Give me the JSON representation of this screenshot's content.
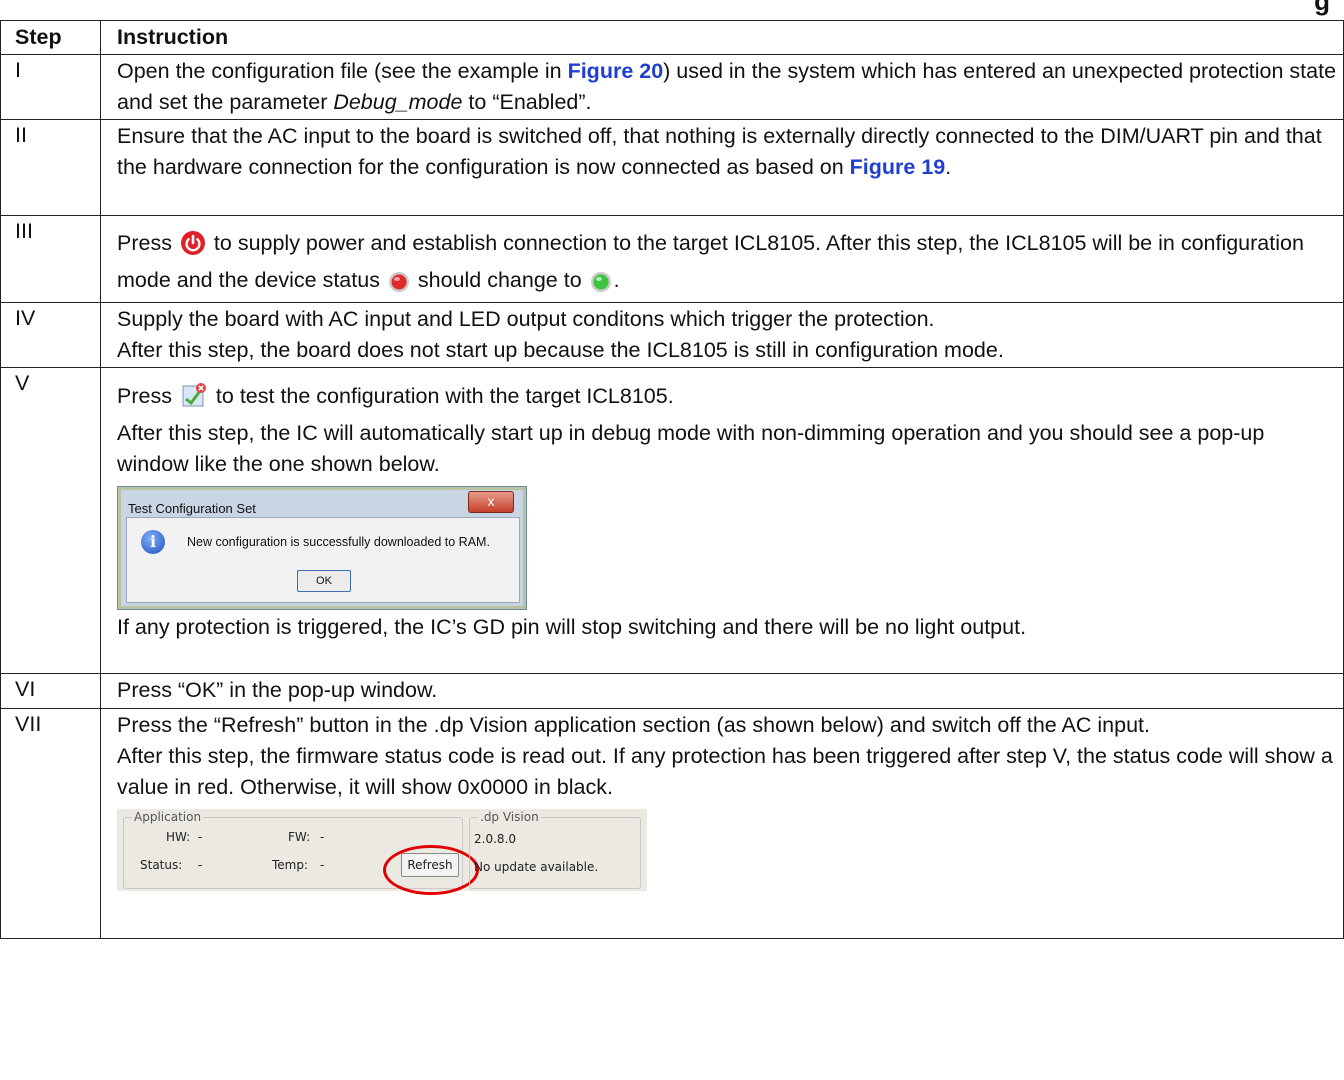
{
  "page": {
    "heading_fragment": "g"
  },
  "table": {
    "header_step": "Step",
    "header_instruction": "Instruction",
    "rows": [
      {
        "step": "I",
        "t1": "Open the configuration file (see the example in ",
        "fig": "Figure 20",
        "t2": ") used in the system which has entered an unexpected protection state and set the parameter ",
        "param": "Debug_mode",
        "t3": " to “Enabled”."
      },
      {
        "step": "II",
        "t1": "Ensure that the AC input to the board is switched off, that nothing is externally directly connected to the DIM/UART pin and that the hardware connection for the configuration is now connected as based on ",
        "fig": "Figure 19",
        "t2": "."
      },
      {
        "step": "III",
        "t1": "Press ",
        "t2": " to supply power and establish connection to the target ICL8105. After this step, the ICL8105 will be in configuration mode and the device status ",
        "t3": " should change to ",
        "t4": "."
      },
      {
        "step": "IV",
        "p1": "Supply the board with AC input and LED output conditons which trigger the protection.",
        "p2": "After this step, the board does not start up because the ICL8105 is still in configuration mode."
      },
      {
        "step": "V",
        "t1": "Press ",
        "t2": " to test the configuration with the target ICL8105.",
        "p2": "After this step, the IC will automatically start up in debug mode with non-dimming operation and you should see a pop-up window like the one shown below.",
        "p3": "If any protection is triggered, the IC’s GD pin will stop switching and there will be no light output."
      },
      {
        "step": "VI",
        "p1": "Press “OK” in the pop-up window."
      },
      {
        "step": "VII",
        "p1": "Press the “Refresh” button in the .dp Vision application section (as shown below) and switch off the AC input.",
        "p2": "After this step, the firmware status code is read out. If any protection has been triggered after step V, the status code will show a value in red. Otherwise, it will show 0x0000 in black."
      }
    ]
  },
  "dialog": {
    "title": "Test Configuration Set",
    "close": "x",
    "message": "New configuration is successfully downloaded to RAM.",
    "ok": "OK",
    "info_glyph": "i"
  },
  "app_panel": {
    "application_legend": "Application",
    "hw_label": "HW:",
    "hw_value": "-",
    "fw_label": "FW:",
    "fw_value": "-",
    "status_label": "Status:",
    "status_value": "-",
    "temp_label": "Temp:",
    "temp_value": "-",
    "refresh": "Refresh",
    "dpvision_legend": ".dp Vision",
    "version": "2.0.8.0",
    "update": "No update available."
  },
  "colors": {
    "figure_link": "#1f3fd0",
    "power_red": "#e0202a",
    "status_green": "#3cc43c",
    "highlight_circle": "#e00000"
  },
  "icons": {
    "power": "power-button-icon",
    "status_red": "red-status-led-icon",
    "status_green": "green-status-led-icon",
    "test_config": "test-configuration-icon"
  }
}
